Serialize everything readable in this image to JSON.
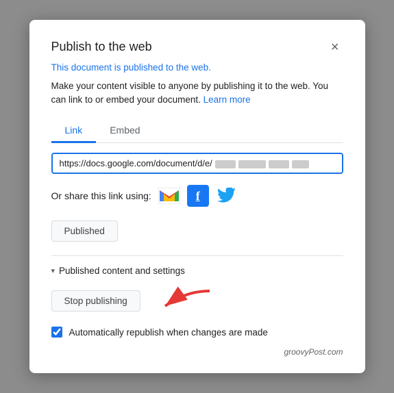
{
  "modal": {
    "title": "Publish to the web",
    "close_label": "×",
    "published_notice": "This document is published to the web.",
    "description": "Make your content visible to anyone by publishing it to the web. You can link to or embed your document.",
    "learn_more_label": "Learn more",
    "tabs": [
      {
        "id": "link",
        "label": "Link",
        "active": true
      },
      {
        "id": "embed",
        "label": "Embed",
        "active": false
      }
    ],
    "url_prefix": "https://docs.google.com/document/d/e/",
    "share_label": "Or share this link using:",
    "published_button": "Published",
    "settings_label": "Published content and settings",
    "stop_button": "Stop publishing",
    "checkbox_label": "Automatically republish when changes are made",
    "watermark": "groovyPost.com"
  }
}
